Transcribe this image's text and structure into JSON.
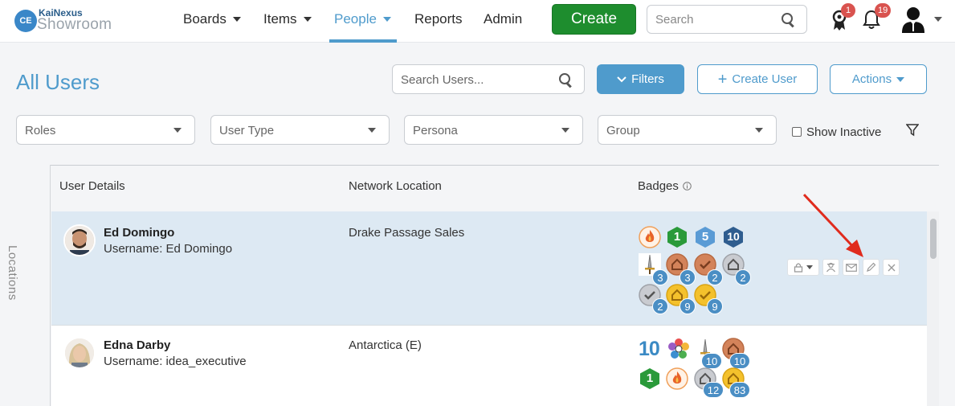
{
  "brand": {
    "initials": "CE",
    "company": "KaiNexus",
    "product": "Showroom"
  },
  "nav": {
    "items": [
      {
        "label": "Boards",
        "dropdown": true
      },
      {
        "label": "Items",
        "dropdown": true
      },
      {
        "label": "People",
        "dropdown": true,
        "active": true
      },
      {
        "label": "Reports",
        "dropdown": false
      },
      {
        "label": "Admin",
        "dropdown": false
      }
    ],
    "create_label": "Create",
    "search_placeholder": "Search",
    "awards_count": "1",
    "notifications_count": "19"
  },
  "page": {
    "title": "All Users",
    "search_placeholder": "Search Users...",
    "filters_label": "Filters",
    "create_user_label": "Create User",
    "actions_label": "Actions"
  },
  "filters": {
    "roles": "Roles",
    "user_type": "User Type",
    "persona": "Persona",
    "group": "Group",
    "show_inactive": "Show Inactive"
  },
  "sidebar": {
    "locations_label": "Locations"
  },
  "table": {
    "headers": {
      "user_details": "User Details",
      "network_location": "Network Location",
      "badges": "Badges"
    },
    "rows": [
      {
        "name": "Ed Domingo",
        "username": "Username: Ed Domingo",
        "location": "Drake Passage Sales",
        "badge_counts": [
          "1",
          "5",
          "10",
          "3",
          "3",
          "2",
          "2",
          "2",
          "9",
          "9"
        ]
      },
      {
        "name": "Edna Darby",
        "username": "Username: idea_executive",
        "location": "Antarctica (E)",
        "badge_counts": [
          "10",
          "10",
          "10",
          "1",
          "12",
          "83"
        ]
      }
    ]
  },
  "colors": {
    "accent": "#4f9bcc",
    "create": "#1e8d2e",
    "alert": "#d9534f",
    "count": "#4a8ec4"
  }
}
